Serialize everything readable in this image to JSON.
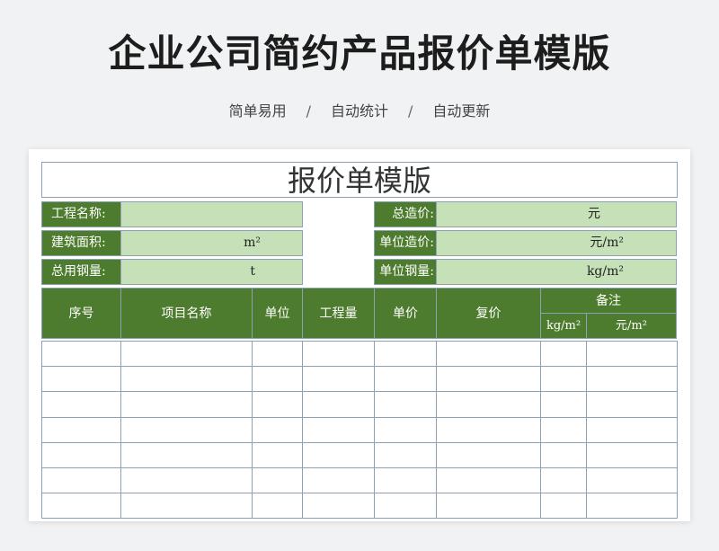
{
  "banner": {
    "title": "企业公司简约产品报价单模版",
    "features": [
      "简单易用",
      "自动统计",
      "自动更新"
    ],
    "separator": "/"
  },
  "sheet": {
    "title": "报价单模版",
    "info_left": [
      {
        "label": "工程名称:",
        "value": "",
        "unit": ""
      },
      {
        "label": "建筑面积:",
        "value": "",
        "unit": "m²"
      },
      {
        "label": "总用钢量:",
        "value": "",
        "unit": "t"
      }
    ],
    "info_right": [
      {
        "label": "总造价:",
        "value": "",
        "unit": "元"
      },
      {
        "label": "单位造价:",
        "value": "",
        "unit": "元/m²"
      },
      {
        "label": "单位钢量:",
        "value": "",
        "unit": "kg/m²"
      }
    ],
    "columns": [
      "序号",
      "项目名称",
      "单位",
      "工程量",
      "单价",
      "复价"
    ],
    "remarks": {
      "label": "备注",
      "sub": [
        "kg/m²",
        "元/m²"
      ]
    },
    "blank_row_count": 7
  },
  "colors": {
    "header_green": "#4e7c2e",
    "value_green": "#c6e1b7",
    "grid": "#8ea0b3",
    "page_bg": "#f1f2f3"
  }
}
